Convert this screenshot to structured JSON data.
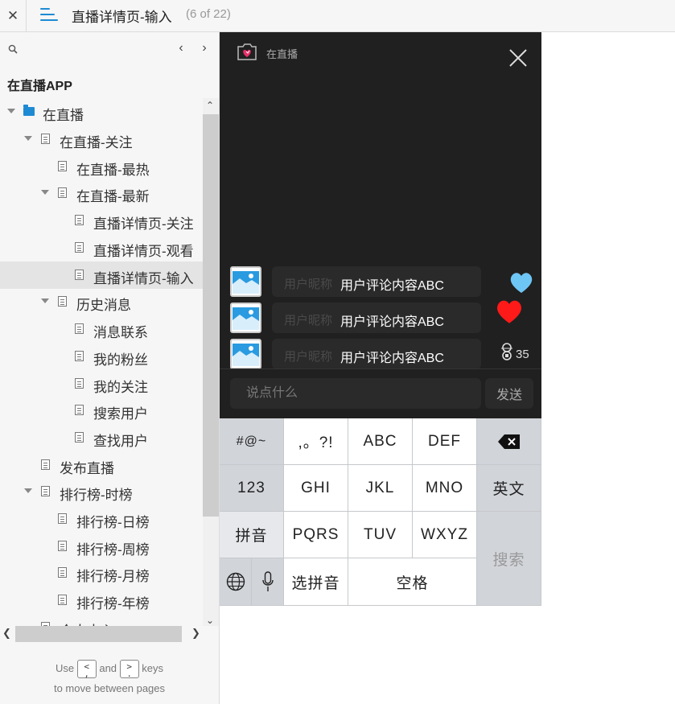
{
  "topbar": {
    "close_icon": "close-icon",
    "menu_icon": "menu-icon",
    "title": "直播详情页-输入",
    "page_count": "(6 of 22)"
  },
  "sidebar": {
    "project_title": "在直播APP",
    "tree": [
      {
        "label": "在直播",
        "icon": "folder-icon",
        "expanded": true
      },
      {
        "label": "在直播-关注",
        "icon": "page-icon",
        "expanded": true
      },
      {
        "label": "在直播-最热",
        "icon": "page-icon"
      },
      {
        "label": "在直播-最新",
        "icon": "page-icon",
        "expanded": true
      },
      {
        "label": "直播详情页-关注",
        "icon": "page-icon"
      },
      {
        "label": "直播详情页-观看",
        "icon": "page-icon"
      },
      {
        "label": "直播详情页-输入",
        "icon": "page-icon",
        "selected": true
      },
      {
        "label": "历史消息",
        "icon": "page-icon",
        "expanded": true
      },
      {
        "label": "消息联系",
        "icon": "page-icon"
      },
      {
        "label": "我的粉丝",
        "icon": "page-icon"
      },
      {
        "label": "我的关注",
        "icon": "page-icon"
      },
      {
        "label": "搜索用户",
        "icon": "page-icon"
      },
      {
        "label": "查找用户",
        "icon": "page-icon"
      },
      {
        "label": "发布直播",
        "icon": "page-icon"
      },
      {
        "label": "排行榜-时榜",
        "icon": "page-icon",
        "expanded": true
      },
      {
        "label": "排行榜-日榜",
        "icon": "page-icon"
      },
      {
        "label": "排行榜-周榜",
        "icon": "page-icon"
      },
      {
        "label": "排行榜-月榜",
        "icon": "page-icon"
      },
      {
        "label": "排行榜-年榜",
        "icon": "page-icon"
      },
      {
        "label": "个人中心",
        "icon": "page-icon"
      }
    ],
    "hint": {
      "use": "Use",
      "and": "and",
      "keys": "keys",
      "line2": "to move between pages",
      "key_prev": "<\n,",
      "key_next": ">\n."
    }
  },
  "phone": {
    "logo_text": "在直播",
    "comments": [
      {
        "nickname": "用户昵称",
        "text": "用户评论内容ABC"
      },
      {
        "nickname": "用户昵称",
        "text": "用户评论内容ABC"
      },
      {
        "nickname": "用户昵称",
        "text": "用户评论内容ABC"
      }
    ],
    "like_count": "35",
    "input_placeholder": "说点什么",
    "send_label": "发送",
    "colors": {
      "heart_blue": "#6ec6f5",
      "heart_red": "#ff1a1a",
      "background": "#202020"
    }
  },
  "keyboard": {
    "rows": [
      [
        "#@~",
        ",。?!",
        "ABC",
        "DEF",
        "delete-icon"
      ],
      [
        "123",
        "GHI",
        "JKL",
        "MNO",
        "英文"
      ],
      [
        "拼音",
        "PQRS",
        "TUV",
        "WXYZ",
        "搜索"
      ],
      [
        "globe-icon",
        "mic-icon",
        "选拼音",
        "空格"
      ]
    ]
  }
}
